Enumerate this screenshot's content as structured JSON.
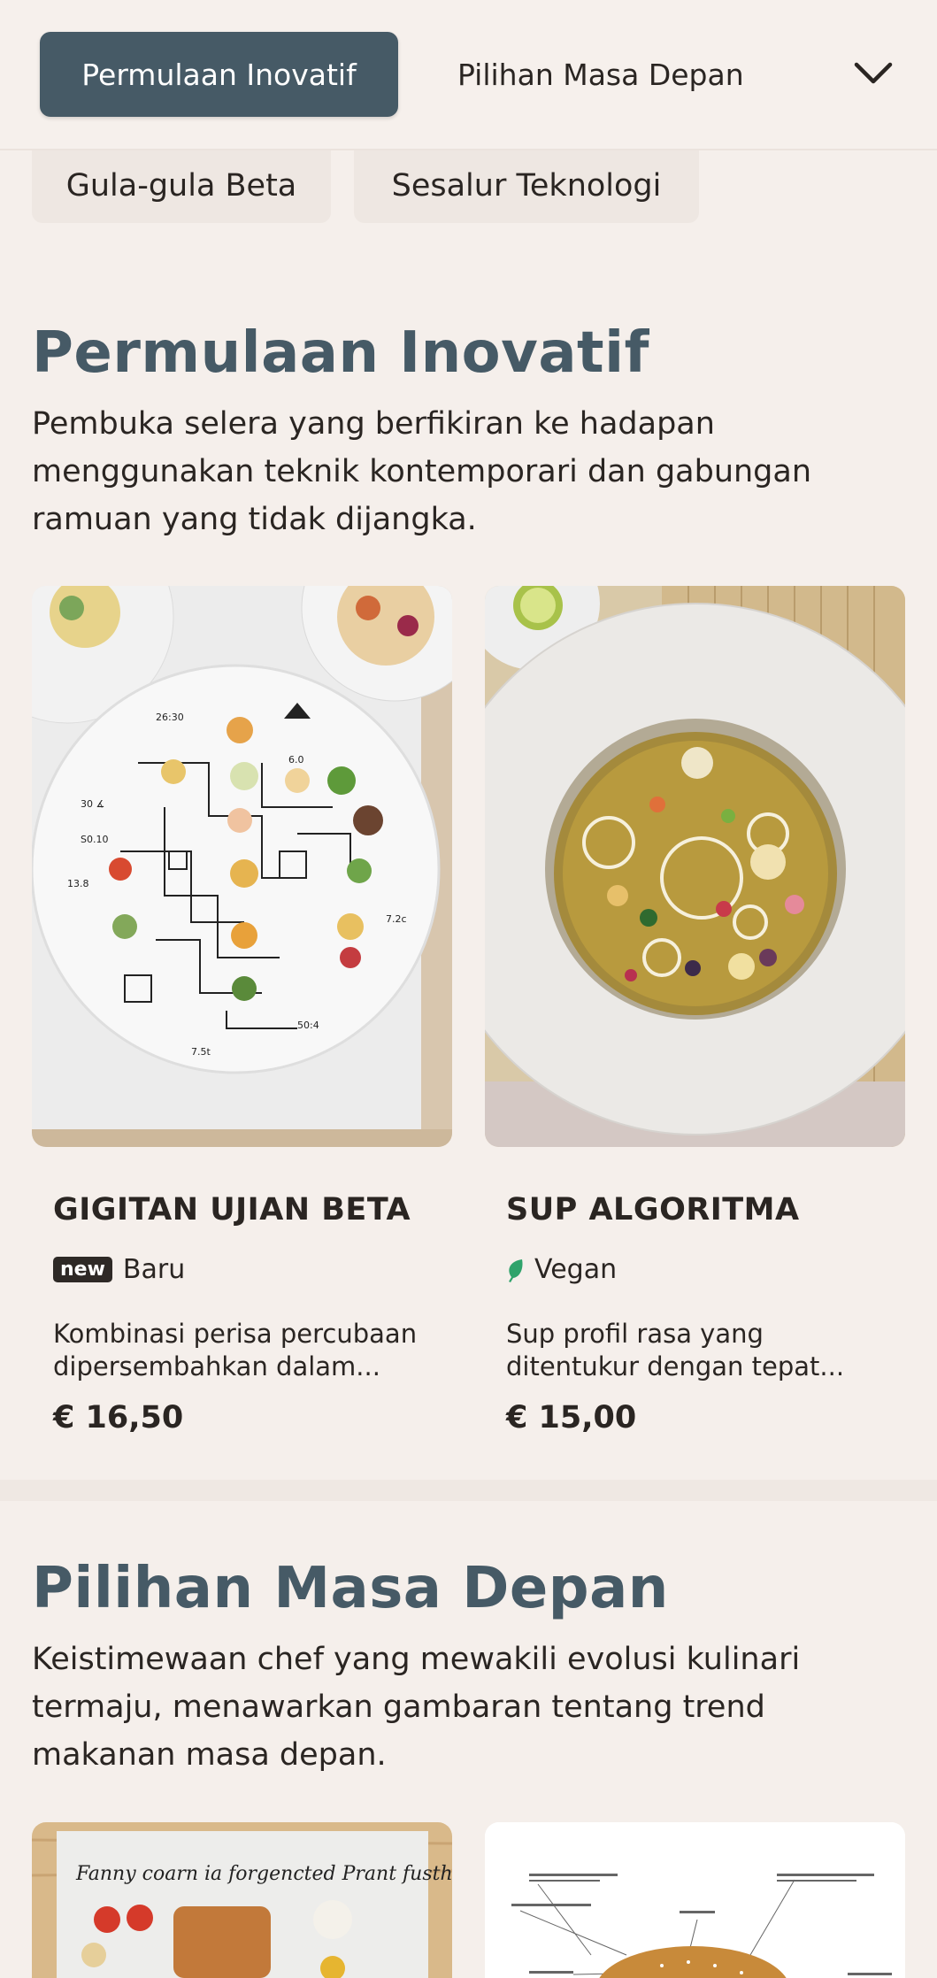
{
  "nav": {
    "tabs": [
      "Permulaan Inovatif",
      "Pilihan Masa Depan"
    ],
    "chips": [
      "Gula-gula Beta",
      "Sesalur Teknologi"
    ]
  },
  "sections": [
    {
      "title": "Permulaan Inovatif",
      "description": "Pembuka selera yang berfikiran ke hadapan menggunakan teknik kontemporari dan gabungan ramuan yang tidak dijangka.",
      "items": [
        {
          "name": "GIGITAN UJIAN BETA",
          "badge_label": "new",
          "tag": "Baru",
          "description": "Kombinasi perisa percubaan dipersembahkan dalam...",
          "price": "€ 16,50"
        },
        {
          "name": "SUP ALGORITMA",
          "tag_icon": "leaf-icon",
          "tag": "Vegan",
          "description": "Sup profil rasa yang ditentukur dengan tepat...",
          "price": "€ 15,00"
        }
      ]
    },
    {
      "title": "Pilihan Masa Depan",
      "description": "Keistimewaan chef yang mewakili evolusi kulinari termaju, menawarkan gambaran tentang trend makanan masa depan.",
      "items": [
        {
          "image_caption": "Fanny coarn   ia forgencted   Prant fusthing"
        }
      ]
    }
  ],
  "colors": {
    "accent": "#465a66",
    "background": "#f5efeb",
    "vegan": "#2fa36b"
  }
}
